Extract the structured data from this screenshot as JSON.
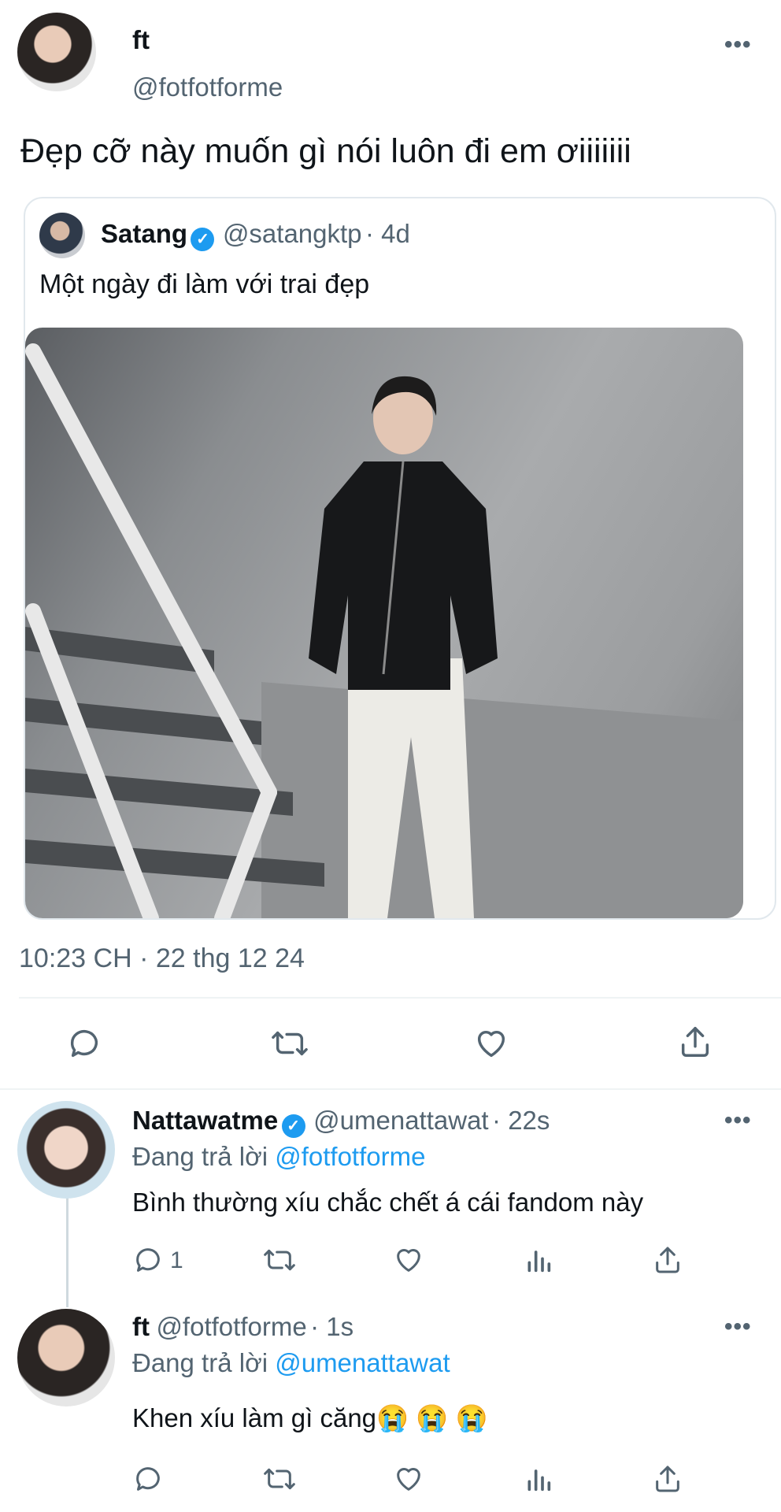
{
  "main_tweet": {
    "name": "ft",
    "handle": "@fotfotforme",
    "text": "Đẹp cỡ này muốn gì nói luôn đi em ơiiiiiii",
    "timestamp": "10:23 CH · 22 thg 12 24"
  },
  "quoted_tweet": {
    "name": "Satang",
    "handle": "@satangktp",
    "time": "· 4d",
    "text": "Một ngày đi làm với trai đẹp"
  },
  "replies": [
    {
      "name": "Nattawatme",
      "handle": "@umenattawat",
      "time": "· 22s",
      "replying_prefix": "Đang trả lời",
      "replying_to": "@fotfotforme",
      "text": "Bình thường xíu chắc chết á cái fandom này",
      "reply_count": "1"
    },
    {
      "name": "ft",
      "handle": "@fotfotforme",
      "time": "· 1s",
      "replying_prefix": "Đang trả lời",
      "replying_to": "@umenattawat",
      "text": "Khen xíu làm gì căng😭 😭 😭"
    }
  ],
  "icons": {
    "reply": "comment-icon",
    "retweet": "retweet-icon",
    "like": "heart-icon",
    "share": "share-icon",
    "analytics": "analytics-icon",
    "more": "more-dots-icon",
    "verified": "verified-badge-icon"
  },
  "colors": {
    "accent": "#1d9bf0",
    "muted": "#536471",
    "text": "#0f1419",
    "divider": "#eff3f4"
  }
}
